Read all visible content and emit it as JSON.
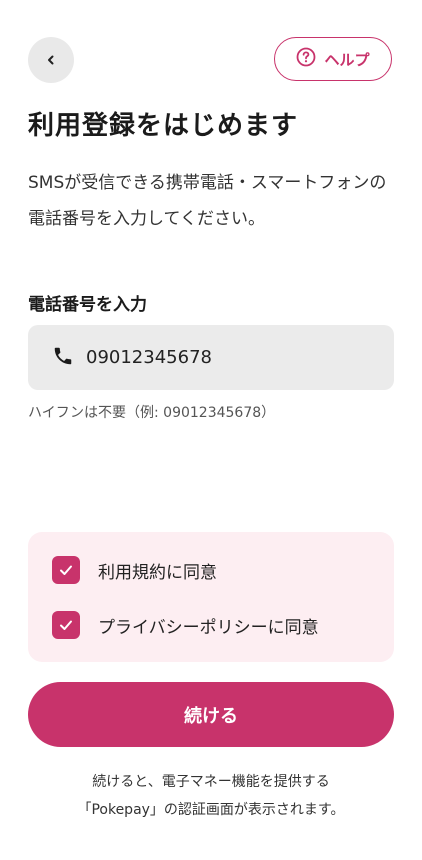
{
  "header": {
    "back_icon": "chevron-left-icon",
    "help_label": "ヘルプ",
    "help_icon": "question-circle-icon"
  },
  "title": "利用登録をはじめます",
  "description": "SMSが受信できる携帯電話・スマートフォンの電話番号を入力してください。",
  "phone": {
    "label": "電話番号を入力",
    "icon": "phone-icon",
    "value": "09012345678",
    "hint": "ハイフンは不要（例: 09012345678）"
  },
  "consents": [
    {
      "label": "利用規約に同意",
      "checked": true
    },
    {
      "label": "プライバシーポリシーに同意",
      "checked": true
    }
  ],
  "continue_label": "続ける",
  "footer_note": {
    "line1": "続けると、電子マネー機能を提供する",
    "line2": "「Pokepay」の認証画面が表示されます。"
  },
  "colors": {
    "accent": "#c8336b",
    "consent_bg": "#fdeef2",
    "input_bg": "#ebebeb",
    "back_bg": "#e9e9e9"
  }
}
